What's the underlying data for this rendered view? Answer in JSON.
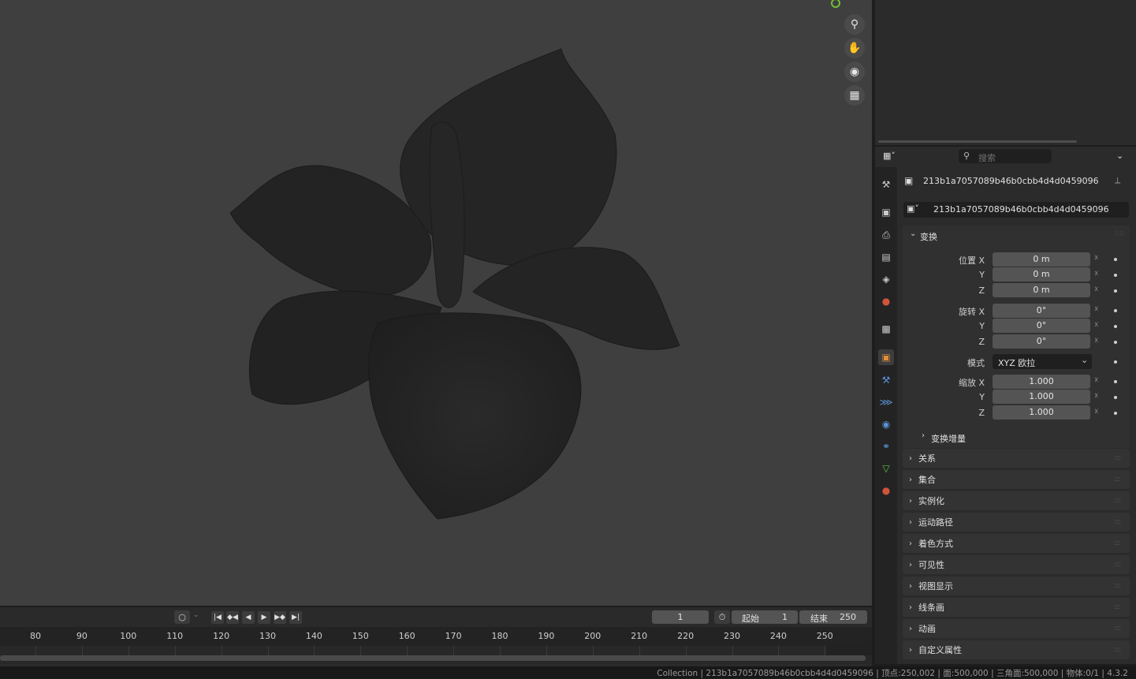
{
  "properties": {
    "search_placeholder": "搜索",
    "object_name": "213b1a7057089b46b0cbb4d4d0459096",
    "object_field": "213b1a7057089b46b0cbb4d4d0459096",
    "transform": {
      "title": "变换",
      "location_label": "位置 X",
      "y": "Y",
      "z": "Z",
      "loc_x": "0 m",
      "loc_y": "0 m",
      "loc_z": "0 m",
      "rotation_label": "旋转 X",
      "rot_x": "0°",
      "rot_y": "0°",
      "rot_z": "0°",
      "mode_label": "模式",
      "mode_value": "XYZ 欧拉",
      "scale_label": "缩放 X",
      "scale_x": "1.000",
      "scale_y": "1.000",
      "scale_z": "1.000",
      "delta_label": "变换增量"
    },
    "panels": [
      "关系",
      "集合",
      "实例化",
      "运动路径",
      "着色方式",
      "可见性",
      "视图显示",
      "线条画",
      "动画",
      "自定义属性"
    ]
  },
  "timeline": {
    "current_frame": "1",
    "start_label": "起始",
    "start_value": "1",
    "end_label": "结束",
    "end_value": "250",
    "ticks": [
      "80",
      "90",
      "100",
      "110",
      "120",
      "130",
      "140",
      "150",
      "160",
      "170",
      "180",
      "190",
      "200",
      "210",
      "220",
      "230",
      "240",
      "250"
    ]
  },
  "status": "Collection | 213b1a7057089b46b0cbb4d4d0459096 | 顶点:250,002 | 面:500,000 | 三角面:500,000 | 物体:0/1 | 4.3.2",
  "colors": {
    "accent_orange": "#e08f3a",
    "viewport_bg": "#3f3f3f",
    "field_bg": "#545454"
  }
}
